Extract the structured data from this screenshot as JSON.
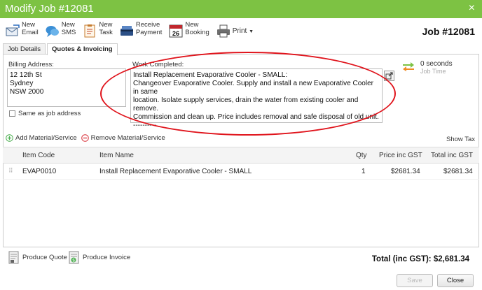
{
  "window": {
    "title": "Modify Job #12081",
    "close_glyph": "×",
    "titlebar_color": "#7dc243"
  },
  "toolbar": {
    "items": [
      {
        "line1": "New",
        "line2": "Email",
        "icon": "email-icon"
      },
      {
        "line1": "New",
        "line2": "SMS",
        "icon": "sms-icon"
      },
      {
        "line1": "New",
        "line2": "Task",
        "icon": "task-icon"
      },
      {
        "line1": "Receive",
        "line2": "Payment",
        "icon": "payment-icon"
      },
      {
        "line1": "New",
        "line2": "Booking",
        "icon": "calendar-icon",
        "calendar_day": "26"
      },
      {
        "line1": "Print",
        "line2": "",
        "icon": "printer-icon"
      }
    ]
  },
  "job": {
    "number_label": "Job #12081"
  },
  "tabs": [
    {
      "label": "Job Details",
      "active": false
    },
    {
      "label": "Quotes & Invoicing",
      "active": true
    }
  ],
  "billing": {
    "label": "Billing Address:",
    "value": "12 12th St\nSydney\nNSW 2000",
    "same_as_label": "Same as job address",
    "same_as_checked": false
  },
  "work": {
    "label": "Work Completed:",
    "value": "Install Replacement Evaporative Cooler - SMALL:\nChangeover Evaporative Cooler. Supply and install a new Evaporative Cooler in same\nlocation. Isolate supply services, drain the water from existing cooler and remove.\nCommission and clean up. Price includes removal and safe disposal of old unit.\n----------"
  },
  "timer": {
    "value": "0 seconds",
    "label": "Job Time"
  },
  "materials": {
    "add_label": "Add Material/Service",
    "remove_label": "Remove Material/Service",
    "show_tax_label": "Show Tax"
  },
  "table": {
    "headers": {
      "code": "Item Code",
      "name": "Item Name",
      "qty": "Qty",
      "price": "Price inc GST",
      "total": "Total inc GST"
    },
    "rows": [
      {
        "code": "EVAP0010",
        "name": "Install Replacement Evaporative Cooler - SMALL",
        "qty": "1",
        "price": "$2681.34",
        "total": "$2681.34"
      }
    ]
  },
  "footer": {
    "produce_quote": "Produce Quote",
    "produce_invoice": "Produce Invoice",
    "total": "Total (inc GST): $2,681.34",
    "save_label": "Save",
    "close_label": "Close"
  },
  "colors": {
    "accent_green": "#7dc243",
    "annotation_red": "#e0141c"
  }
}
